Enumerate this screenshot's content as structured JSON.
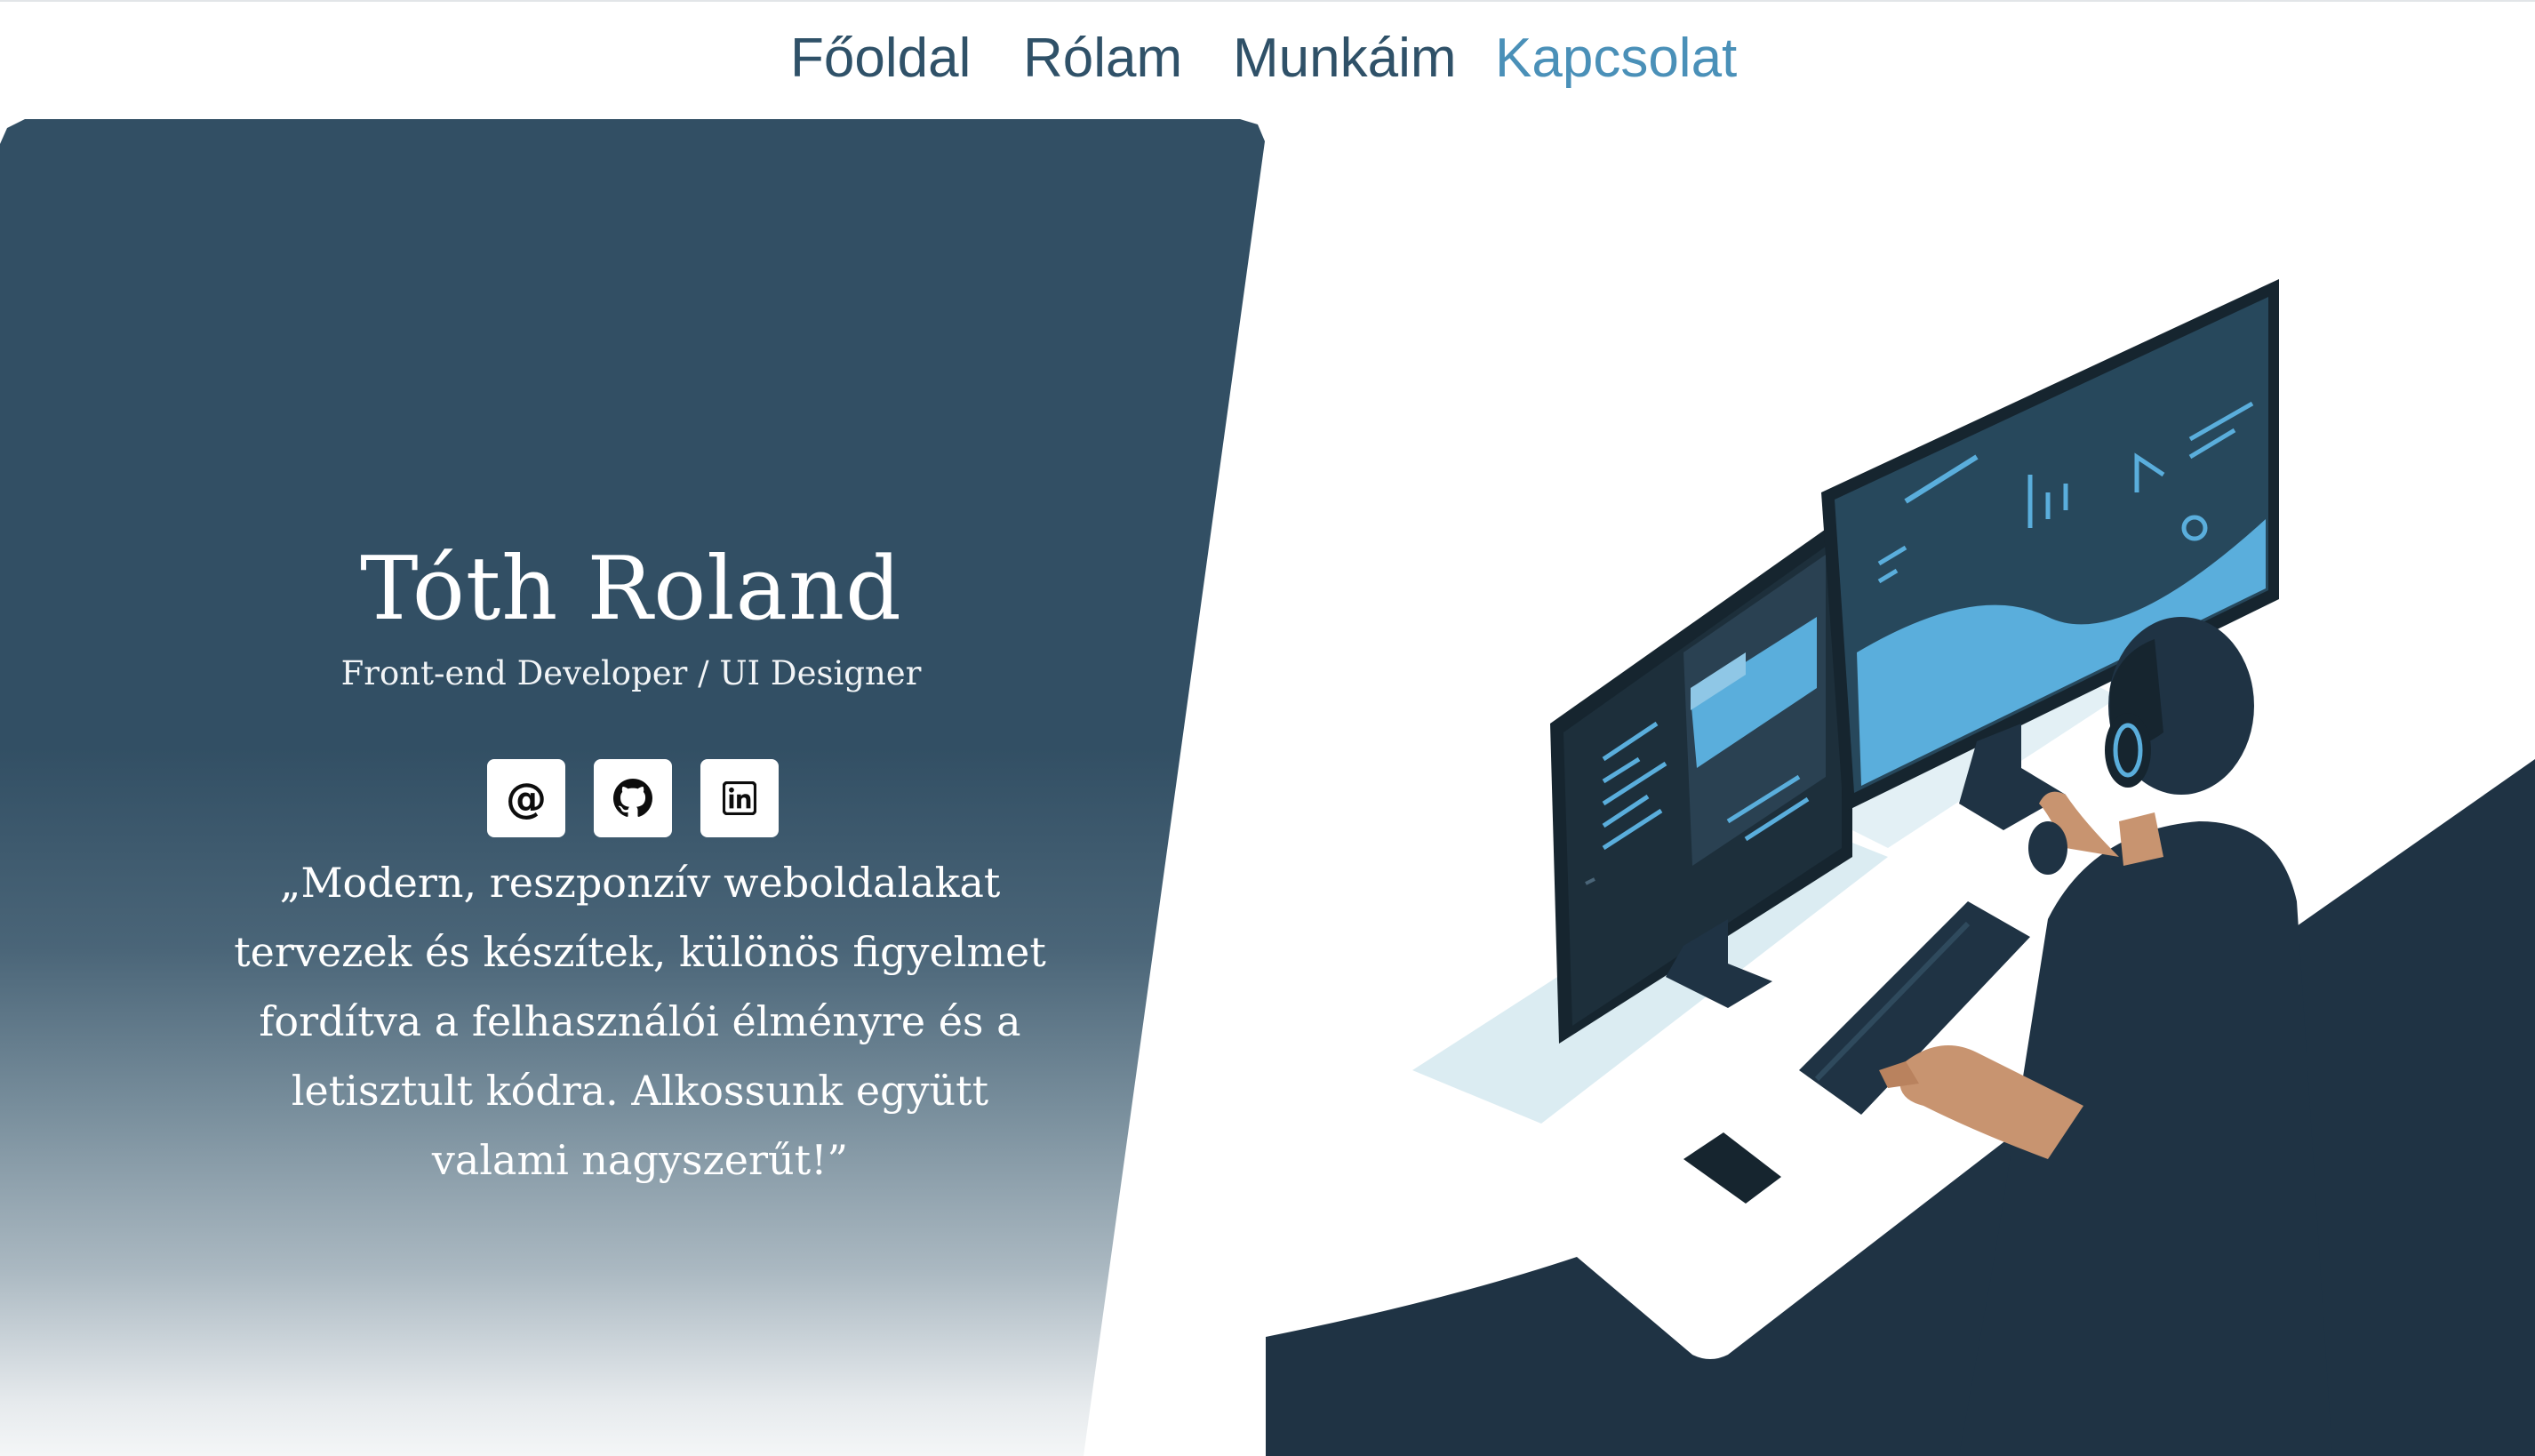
{
  "nav": {
    "items": [
      {
        "label": "Főoldal",
        "active": false
      },
      {
        "label": "Rólam",
        "active": false
      },
      {
        "label": "Munkáim",
        "active": false
      },
      {
        "label": "Kapcsolat",
        "active": true
      }
    ]
  },
  "hero": {
    "name": "Tóth Roland",
    "role": "Front-end Developer / UI Designer",
    "quote": "„Modern, reszponzív weboldalakat tervezek és készítek, különös figyelmet fordítva a felhasználói élményre és a letisztult kódra. Alkossunk együtt valami nagyszerűt!”",
    "socials": [
      {
        "icon": "at-sign-icon",
        "glyph": "@"
      },
      {
        "icon": "github-icon"
      },
      {
        "icon": "linkedin-icon"
      }
    ]
  },
  "colors": {
    "nav_text": "#2f5168",
    "nav_active": "#4a90b8",
    "hero_bg": "#324f64",
    "illustration_dark": "#1f3344",
    "illustration_accent": "#5aaedc"
  }
}
